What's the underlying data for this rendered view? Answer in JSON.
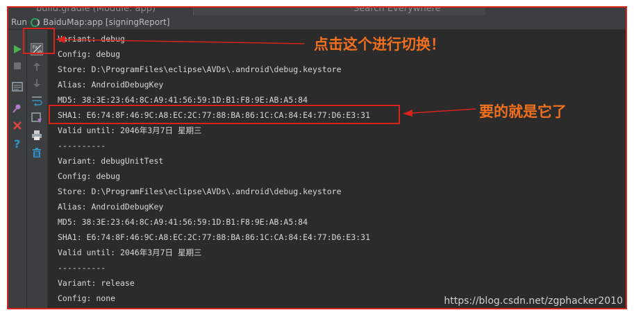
{
  "colors": {
    "highlight": "#d9231c",
    "annotation": "#f07020",
    "console_bg": "#2b2b2b",
    "panel_bg": "#3c3f41",
    "text": "#d8d8d8",
    "run_green": "#4caf50"
  },
  "top_strip": {
    "file_tab": "build.gradle (Module: app)",
    "search": "Search Everywhere"
  },
  "run_bar": {
    "label": "Run",
    "config": "BaiduMap:app [signingReport]"
  },
  "left_toolbar": {
    "icons": [
      "run-icon",
      "stop-icon",
      "layout-icon",
      "pin-icon",
      "close-icon",
      "help-icon"
    ]
  },
  "right_toolbar": {
    "icons": [
      "toggle-view-icon",
      "scroll-up-icon",
      "scroll-down-icon",
      "soft-wrap-icon",
      "scroll-to-end-icon",
      "print-icon",
      "trash-icon"
    ]
  },
  "console": {
    "lines": [
      "Variant: debug",
      "Config: debug",
      "Store: D:\\ProgramFiles\\eclipse\\AVDs\\.android\\debug.keystore",
      "Alias: AndroidDebugKey",
      "MD5: 38:3E:23:64:8C:A9:41:56:59:1D:B1:F8:9E:AB:A5:84",
      "SHA1: E6:74:8F:46:9C:A8:EC:2C:77:88:BA:86:1C:CA:84:E4:77:D6:E3:31",
      "Valid until: 2046年3月7日 星期三",
      "----------",
      "Variant: debugUnitTest",
      "Config: debug",
      "Store: D:\\ProgramFiles\\eclipse\\AVDs\\.android\\debug.keystore",
      "Alias: AndroidDebugKey",
      "MD5: 38:3E:23:64:8C:A9:41:56:59:1D:B1:F8:9E:AB:A5:84",
      "SHA1: E6:74:8F:46:9C:A8:EC:2C:77:88:BA:86:1C:CA:84:E4:77:D6:E3:31",
      "Valid until: 2046年3月7日 星期三",
      "----------",
      "Variant: release",
      "Config: none"
    ]
  },
  "annotations": {
    "toggle_hint": "点击这个进行切换！",
    "sha1_hint": "要的就是它了"
  },
  "watermark": "https://blog.csdn.net/zgphacker2010"
}
